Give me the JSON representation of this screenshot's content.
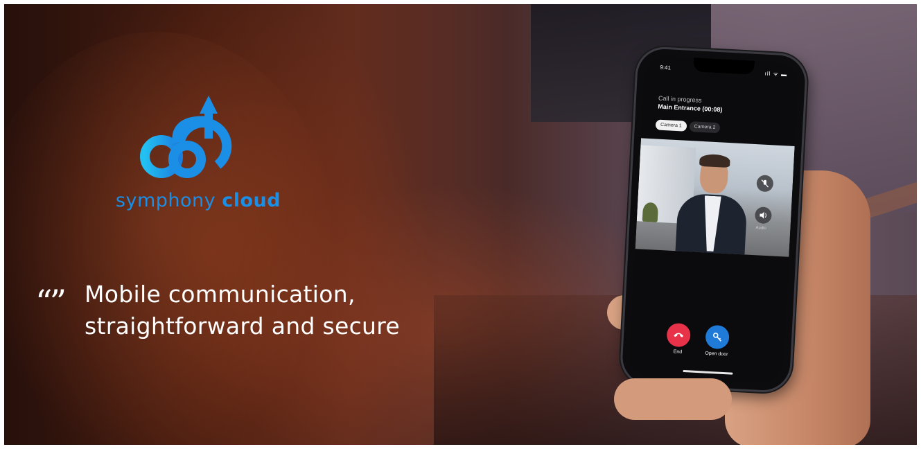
{
  "brand": {
    "name_part1": "symphony",
    "name_part2": "cloud",
    "logo_icon": "cloud-upload-icon",
    "colors": {
      "primary": "#1b8ee6",
      "accent": "#23b5f0"
    }
  },
  "tagline": {
    "line1": "Mobile communication,",
    "line2": "straightforward and secure",
    "quote_icon": "quote-icon"
  },
  "phone": {
    "status_time": "9:41",
    "status_icons": "ıll ᯤ ▬",
    "call_label": "Call in progress",
    "call_title": "Main Entrance (00:08)",
    "camera_tabs": [
      "Camera 1",
      "Camera 2"
    ],
    "active_camera": "Camera 1",
    "video_controls": [
      {
        "icon": "microphone-muted-icon",
        "label": ""
      },
      {
        "icon": "speaker-icon",
        "label": "Audio"
      }
    ],
    "actions": [
      {
        "icon": "phone-hangup-icon",
        "label": "End",
        "color": "#e8324a"
      },
      {
        "icon": "key-icon",
        "label": "Open door",
        "color": "#1f7ad8"
      }
    ]
  }
}
